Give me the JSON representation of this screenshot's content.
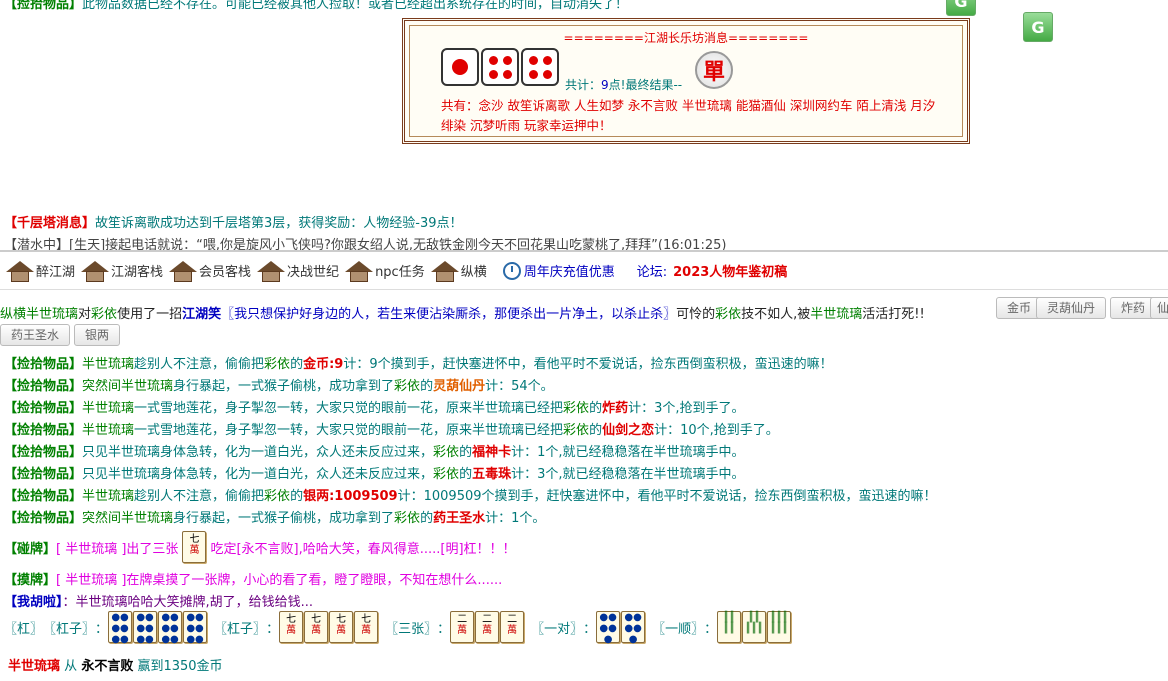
{
  "top": {
    "line1_tag": "【捡拾物品】",
    "line1_text": "此物品数据已经不存在。可能已经被其他人捡取！或者已经超出系统存在的时间，自动消失了！",
    "jianghu": {
      "title": "========江湖长乐坊消息========",
      "dice_values": [
        1,
        4,
        4
      ],
      "total_label": "共计：",
      "total_value": "9",
      "total_suffix": "点!最终结果--",
      "result": "單",
      "shared_prefix": "共有：",
      "shared_names": "念沙 故笙诉离歌 人生如梦 永不言败 半世琉璃 能猫酒仙 深圳网约车 陌上清浅 月汐绯染 沉梦听雨 玩家幸运押中！"
    },
    "tower_tag": "【千层塔消息】",
    "tower_text": "故笙诉离歌成功达到千层塔第3层，获得奖励：人物经验-39点！",
    "marquee": "【潜水中】[生天]接起电话就说：“喂,你是旋风小飞侠吗?你跟女绍人说,无敌铁金刚今天不回花果山吃蒙桃了,拜拜”(16:01:25)"
  },
  "nav": {
    "items": [
      "醉江湖",
      "江湖客栈",
      "会员客栈",
      "决战世纪",
      "npc任务",
      "纵横"
    ],
    "recharge": "周年庆充值优惠",
    "forum_label": "论坛:",
    "forum_link": "2023人物年鉴初稿"
  },
  "log": {
    "attack": {
      "p1": "纵横",
      "p2": "半世琉璃",
      "p3": "对",
      "p4": "彩依",
      "p5": "使用了一招",
      "skill": "江湖笑",
      "quote": "〖我只想保护好身边的人，若生来便沾染厮杀，那便杀出一片净土，以杀止杀〗",
      "p6": "可怜的",
      "p7": "彩依",
      "p8": "技不如人,被",
      "p9": "半世琉璃",
      "p10": "活活打死!!"
    },
    "buttons": [
      "金币",
      "灵葫仙丹",
      "炸药",
      "仙",
      "药王圣水",
      "银两"
    ],
    "pickups": [
      {
        "tag": "【捡拾物品】",
        "a": "半世琉璃",
        "b": "趁别人不注意，偷偷把",
        "c": "彩依",
        "d": "的",
        "item": "金币:9",
        "e": "计：9个摸到手，赶快塞进怀中，看他平时不爱说话，捡东西倒蛮积极，蛮迅速的嘛！"
      },
      {
        "tag": "【捡拾物品】",
        "a": "突然间半世琉璃",
        "b": "身行暴起，一式猴子偷桃，成功拿到了",
        "c": "彩依",
        "d": "的",
        "item": "灵葫仙丹",
        "e": "计：54个。"
      },
      {
        "tag": "【捡拾物品】",
        "a": "半世琉璃",
        "b": "一式雪地莲花，身子掣忽一转，大家只觉的眼前一花，原来半世琉璃已经把",
        "c": "彩依",
        "d": "的",
        "item": "炸药",
        "e": "计：3个,抢到手了。"
      },
      {
        "tag": "【捡拾物品】",
        "a": "半世琉璃",
        "b": "一式雪地莲花，身子掣忽一转，大家只觉的眼前一花，原来半世琉璃已经把",
        "c": "彩依",
        "d": "的",
        "item": "仙剑之恋",
        "e": "计：10个,抢到手了。"
      },
      {
        "tag": "【捡拾物品】",
        "a": "只见半世琉璃",
        "b": "身体急转，化为一道白光，众人还未反应过来，",
        "c": "彩依",
        "d": "的",
        "item": "福神卡",
        "e": "计：1个,就已经稳稳落在半世琉璃手中。"
      },
      {
        "tag": "【捡拾物品】",
        "a": "只见半世琉璃",
        "b": "身体急转，化为一道白光，众人还未反应过来，",
        "c": "彩依",
        "d": "的",
        "item": "五毒珠",
        "e": "计：3个,就已经稳稳落在半世琉璃手中。"
      },
      {
        "tag": "【捡拾物品】",
        "a": "半世琉璃",
        "b": "趁别人不注意，偷偷把",
        "c": "彩依",
        "d": "的",
        "item": "银两:1009509",
        "e": "计：1009509个摸到手，赶快塞进怀中，看他平时不爱说话，捡东西倒蛮积极，蛮迅速的嘛！"
      },
      {
        "tag": "【捡拾物品】",
        "a": "突然间半世琉璃",
        "b": "身行暴起，一式猴子偷桃，成功拿到了",
        "c": "彩依",
        "d": "的",
        "item": "药王圣水",
        "e": "计：1个。"
      }
    ],
    "peng": {
      "tag": "【碰牌】",
      "a": "[ 半世琉璃 ]出了三张",
      "tile": "七萬",
      "b": "吃定[永不言败],哈哈大笑，春风得意.....[明]杠！！！"
    },
    "mo": {
      "tag": "【摸牌】",
      "a": "[ 半世琉璃 ]在牌桌摸了一张牌，小心的看了看，瞪了瞪眼，不知在想什么......"
    },
    "hu": {
      "tag": "【我胡啦】",
      "a": "：半世琉璃哈哈大笑摊牌,胡了，给钱给钱..."
    },
    "mahjong": {
      "gang_label": "〖杠〗",
      "gangzi_label1": "〖杠子〗",
      "gangzi_label2": "〖杠子〗",
      "sanzhang_label": "〖三张〗",
      "yidui_label": "〖一对〗",
      "yishun_label": "〖一顺〗",
      "colon": "："
    },
    "winner": {
      "name": "半世琉璃",
      "from": "从",
      "loser": "永不言败",
      "result": "赢到1350金币"
    }
  }
}
